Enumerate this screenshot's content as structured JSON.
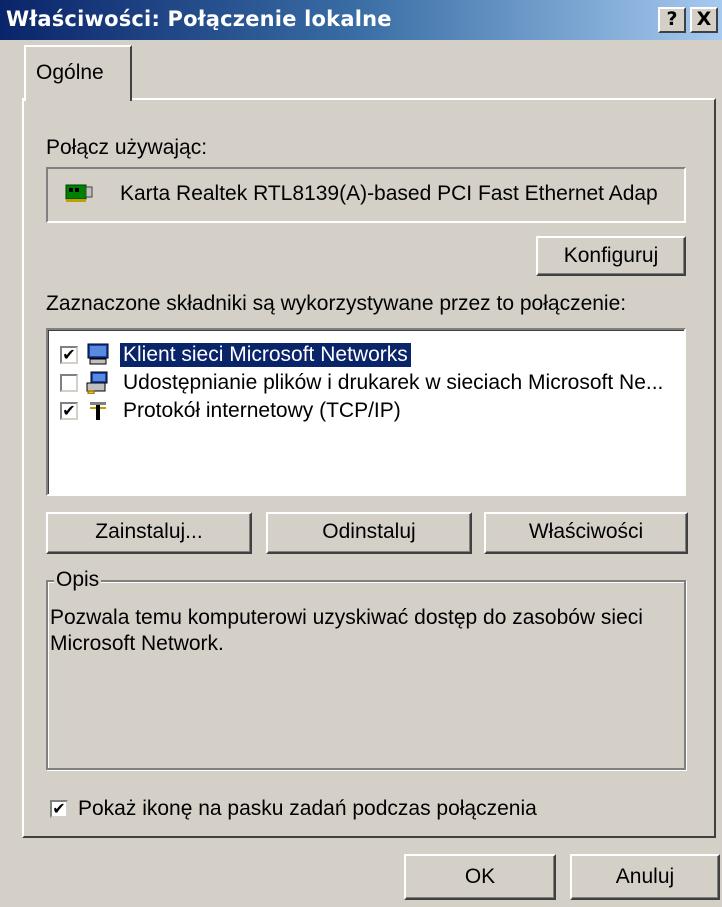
{
  "window": {
    "title": "Właściwości: Połączenie lokalne",
    "help_label": "?",
    "close_label": "X"
  },
  "tabs": [
    {
      "label": "Ogólne",
      "active": true
    }
  ],
  "connect_using": {
    "label": "Połącz używając:",
    "adapter": "Karta Realtek RTL8139(A)-based PCI Fast Ethernet Adap",
    "adapter_icon": "network-card-icon",
    "configure_label": "Konfiguruj"
  },
  "components": {
    "label": "Zaznaczone składniki są wykorzystywane przez to połączenie:",
    "items": [
      {
        "label": "Klient sieci Microsoft Networks",
        "checked": true,
        "icon": "computer-icon",
        "selected": true
      },
      {
        "label": "Udostępnianie plików i drukarek w sieciach Microsoft Ne...",
        "checked": false,
        "icon": "printer-share-icon",
        "selected": false
      },
      {
        "label": "Protokół internetowy (TCP/IP)",
        "checked": true,
        "icon": "protocol-icon",
        "selected": false
      }
    ]
  },
  "buttons": {
    "install": "Zainstaluj...",
    "uninstall": "Odinstaluj",
    "properties": "Właściwości"
  },
  "description": {
    "title": "Opis",
    "text_line1": "Pozwala temu komputerowi uzyskiwać dostęp do zasobów sieci",
    "text_line2": "Microsoft Network."
  },
  "show_icon": {
    "label": "Pokaż ikonę na pasku zadań podczas połączenia",
    "checked": true
  },
  "footer": {
    "ok": "OK",
    "cancel": "Anuluj"
  },
  "colors": {
    "title_start": "#0a246a",
    "title_end": "#a6caf0",
    "face": "#d4d0c8",
    "selection": "#0a246a"
  }
}
